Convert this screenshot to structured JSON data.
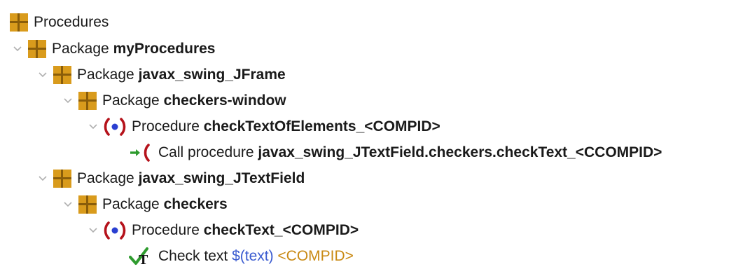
{
  "tree": {
    "root": {
      "label": "Procedures"
    },
    "rows": [
      {
        "kind": "Package",
        "name": "myProcedures"
      },
      {
        "kind": "Package",
        "name": "javax_swing_JFrame"
      },
      {
        "kind": "Package",
        "name": "checkers-window"
      },
      {
        "kind": "Procedure",
        "name": "checkTextOfElements_",
        "suffix": "<COMPID>"
      },
      {
        "kind": "Call procedure",
        "name": "javax_swing_JTextField.checkers.checkText_",
        "suffix": "<CCOMPID>"
      },
      {
        "kind": "Package",
        "name": "javax_swing_JTextField"
      },
      {
        "kind": "Package",
        "name": "checkers"
      },
      {
        "kind": "Procedure",
        "name": "checkText_",
        "suffix": "<COMPID>"
      },
      {
        "kind": "Check text",
        "var": "$(text)",
        "tag": "<COMPID>"
      }
    ]
  },
  "icons": {
    "package": "package-icon",
    "procedure": "procedure-icon",
    "call": "call-procedure-icon",
    "check": "check-text-icon",
    "expand": "chevron-down-icon"
  },
  "colors": {
    "package_fill": "#d99b1c",
    "procedure_red": "#b5121b",
    "procedure_blue": "#2a3fd1",
    "call_green": "#2e9b2e",
    "check_green": "#2e9b2e",
    "variable_blue": "#3a5bd0",
    "tag_orange": "#c98a14"
  }
}
